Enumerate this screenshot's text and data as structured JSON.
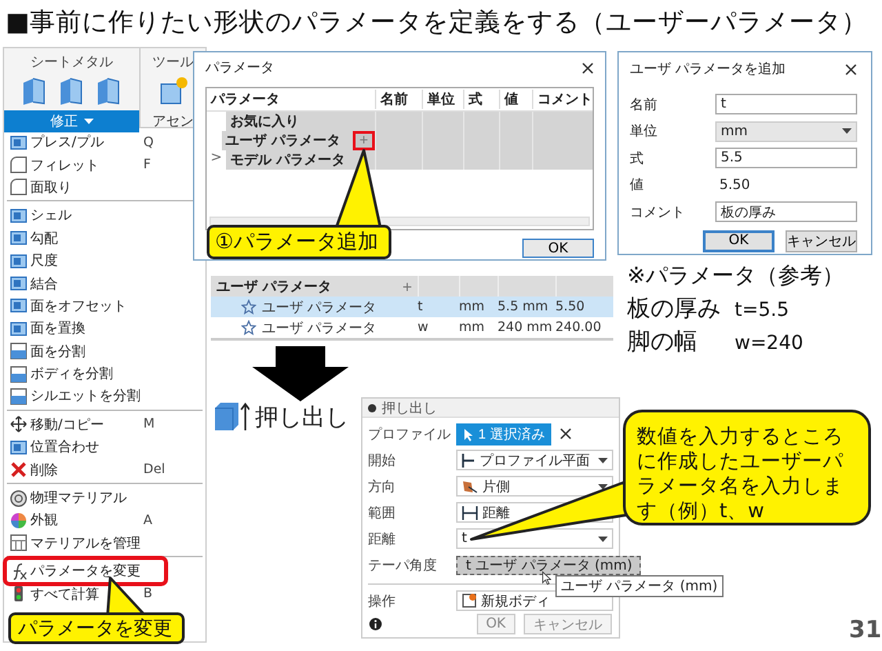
{
  "title": "■事前に作りたい形状のパラメータを定義をする（ユーザーパラメータ）",
  "menu": {
    "ribbon": [
      {
        "label": "シートメタル",
        "tab": "修正",
        "active": true
      },
      {
        "label": "ツール",
        "tab": "アセン",
        "active": false
      }
    ],
    "sections": [
      {
        "items": [
          {
            "label": "プレス/プル",
            "shortcut": "Q",
            "marked": false
          },
          {
            "label": "フィレット",
            "shortcut": "F",
            "marked": false
          },
          {
            "label": "面取り",
            "marked": false
          }
        ]
      },
      {
        "items": [
          {
            "label": "シェル",
            "marked": false
          },
          {
            "label": "勾配",
            "marked": false
          },
          {
            "label": "尺度",
            "marked": false
          },
          {
            "label": "結合",
            "marked": false
          },
          {
            "label": "面をオフセット",
            "marked": false
          },
          {
            "label": "面を置換",
            "marked": false
          },
          {
            "label": "面を分割",
            "marked": false
          },
          {
            "label": "ボディを分割",
            "marked": false
          },
          {
            "label": "シルエットを分割",
            "marked": false
          }
        ]
      },
      {
        "items": [
          {
            "label": "移動/コピー",
            "shortcut": "M",
            "marked": false
          },
          {
            "label": "位置合わせ",
            "marked": false
          },
          {
            "label": "削除",
            "shortcut": "Del",
            "marked": false
          }
        ]
      },
      {
        "items": [
          {
            "label": "物理マテリアル",
            "marked": false
          },
          {
            "label": "外観",
            "shortcut": "A",
            "marked": false
          },
          {
            "label": "マテリアルを管理",
            "marked": false
          }
        ]
      },
      {
        "items": [
          {
            "label": "パラメータを変更",
            "marked": true
          },
          {
            "label": "すべて計算",
            "shortcut": "B",
            "marked": false
          }
        ]
      }
    ],
    "callout": "パラメータを変更"
  },
  "parameters_dialog": {
    "title": "パラメータ",
    "columns": [
      "パラメータ",
      "名前",
      "単位",
      "式",
      "値",
      "コメント"
    ],
    "rows": [
      {
        "label": "お気に入り",
        "marked": false
      },
      {
        "label": "ユーザ パラメータ",
        "add": "+",
        "marked": true
      },
      {
        "label": "モデル パラメータ",
        "expander": ">",
        "marked": false
      }
    ],
    "button": "OK",
    "callout": "①パラメータ追加"
  },
  "add_dialog": {
    "title": "ユーザ パラメータを追加",
    "fields": [
      {
        "label": "名前",
        "kind": "input",
        "value": "t"
      },
      {
        "label": "単位",
        "kind": "select",
        "value": "mm"
      },
      {
        "label": "式",
        "kind": "input",
        "value": "5.5"
      },
      {
        "label": "値",
        "kind": "text",
        "value": "5.50"
      },
      {
        "label": "コメント",
        "kind": "input",
        "value": "板の厚み"
      }
    ],
    "buttons": [
      {
        "label": "OK",
        "default": true
      },
      {
        "label": "キャンセル",
        "default": false
      }
    ]
  },
  "user_table": {
    "header": "ユーザ パラメータ",
    "add": "+",
    "rows": [
      {
        "label": "ユーザ パラメータ",
        "cells": [
          "t",
          "mm",
          "5.5 mm",
          "5.50"
        ],
        "selected": true
      },
      {
        "label": "ユーザ パラメータ",
        "cells": [
          "w",
          "mm",
          "240 mm",
          "240.00"
        ],
        "selected": false
      }
    ]
  },
  "notes": {
    "heading": "※パラメータ（参考）",
    "lines": [
      {
        "name": "板の厚み",
        "value": "t=5.5"
      },
      {
        "name": "脚の幅",
        "value": "w=240"
      }
    ]
  },
  "extrude": {
    "tool_label": "押し出し",
    "title": "押し出し",
    "rows": [
      {
        "label": "プロファイル",
        "kind": "chip",
        "value": "1 選択済み"
      },
      {
        "label": "開始",
        "kind": "select",
        "value": "プロファイル平面"
      },
      {
        "label": "方向",
        "kind": "select",
        "value": "片側"
      },
      {
        "label": "範囲",
        "kind": "field",
        "value": "距離"
      },
      {
        "label": "距離",
        "kind": "entry",
        "value": "t"
      },
      {
        "label": "テーパ角度",
        "kind": "suggestion",
        "value": "t ユーザ パラメータ (mm)"
      },
      {
        "label": "操作",
        "kind": "field",
        "value": "新規ボディ"
      }
    ],
    "tooltip": "ユーザ パラメータ (mm)",
    "buttons": [
      "OK",
      "キャンセル"
    ],
    "callout": "数値を入力するところに作成したユーザーパラメータ名を入力します（例）t、w"
  },
  "page_number": "31"
}
